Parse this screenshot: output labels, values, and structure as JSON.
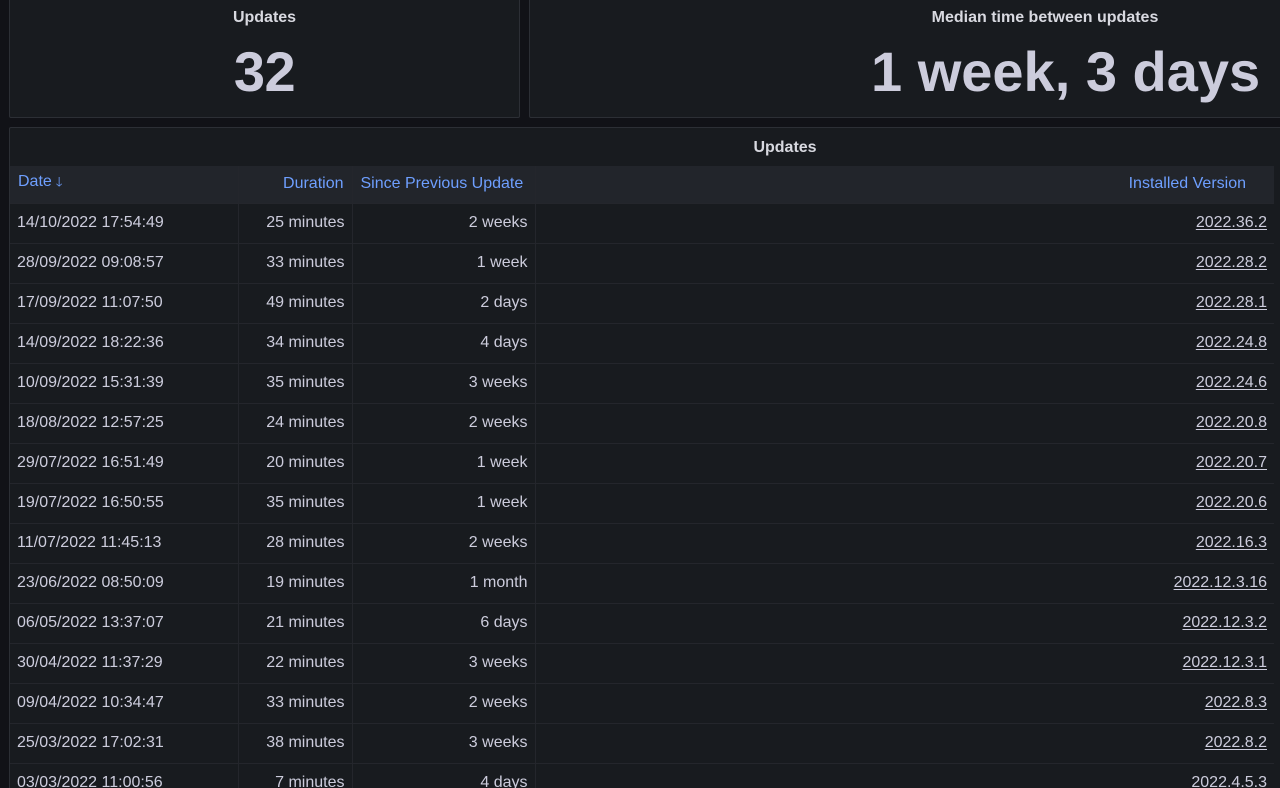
{
  "updates_stat": {
    "title": "Updates",
    "value": "32"
  },
  "median_stat": {
    "title": "Median time between updates",
    "value": "1 week, 3 days"
  },
  "updates_table": {
    "title": "Updates",
    "columns": {
      "date": "Date",
      "duration": "Duration",
      "since_previous": "Since Previous Update",
      "installed_version": "Installed Version"
    },
    "sort_icon": "arrow-down-icon",
    "rows": [
      {
        "date": "14/10/2022 17:54:49",
        "duration": "25 minutes",
        "since": "2 weeks",
        "version": "2022.36.2"
      },
      {
        "date": "28/09/2022 09:08:57",
        "duration": "33 minutes",
        "since": "1 week",
        "version": "2022.28.2"
      },
      {
        "date": "17/09/2022 11:07:50",
        "duration": "49 minutes",
        "since": "2 days",
        "version": "2022.28.1"
      },
      {
        "date": "14/09/2022 18:22:36",
        "duration": "34 minutes",
        "since": "4 days",
        "version": "2022.24.8"
      },
      {
        "date": "10/09/2022 15:31:39",
        "duration": "35 minutes",
        "since": "3 weeks",
        "version": "2022.24.6"
      },
      {
        "date": "18/08/2022 12:57:25",
        "duration": "24 minutes",
        "since": "2 weeks",
        "version": "2022.20.8"
      },
      {
        "date": "29/07/2022 16:51:49",
        "duration": "20 minutes",
        "since": "1 week",
        "version": "2022.20.7"
      },
      {
        "date": "19/07/2022 16:50:55",
        "duration": "35 minutes",
        "since": "1 week",
        "version": "2022.20.6"
      },
      {
        "date": "11/07/2022 11:45:13",
        "duration": "28 minutes",
        "since": "2 weeks",
        "version": "2022.16.3"
      },
      {
        "date": "23/06/2022 08:50:09",
        "duration": "19 minutes",
        "since": "1 month",
        "version": "2022.12.3.16"
      },
      {
        "date": "06/05/2022 13:37:07",
        "duration": "21 minutes",
        "since": "6 days",
        "version": "2022.12.3.2"
      },
      {
        "date": "30/04/2022 11:37:29",
        "duration": "22 minutes",
        "since": "3 weeks",
        "version": "2022.12.3.1"
      },
      {
        "date": "09/04/2022 10:34:47",
        "duration": "33 minutes",
        "since": "2 weeks",
        "version": "2022.8.3"
      },
      {
        "date": "25/03/2022 17:02:31",
        "duration": "38 minutes",
        "since": "3 weeks",
        "version": "2022.8.2"
      },
      {
        "date": "03/03/2022 11:00:56",
        "duration": "7 minutes",
        "since": "4 days",
        "version": "2022.4.5.3"
      }
    ]
  },
  "colors": {
    "background": "#111217",
    "panel": "#181b1f",
    "header_row": "#22252b",
    "header_text": "#6e9fff",
    "text": "#ccccdc"
  }
}
